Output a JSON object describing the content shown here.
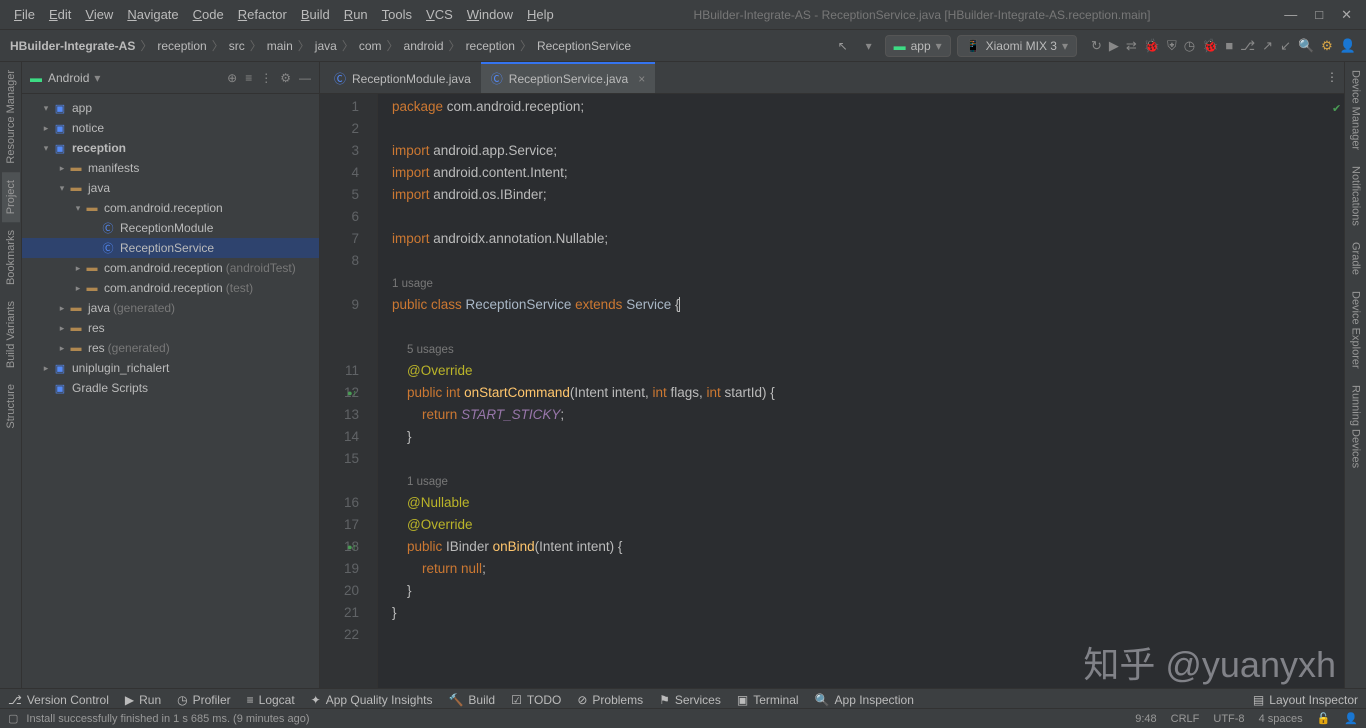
{
  "title": "HBuilder-Integrate-AS - ReceptionService.java [HBuilder-Integrate-AS.reception.main]",
  "menus": [
    "File",
    "Edit",
    "View",
    "Navigate",
    "Code",
    "Refactor",
    "Build",
    "Run",
    "Tools",
    "VCS",
    "Window",
    "Help"
  ],
  "breadcrumb": [
    "HBuilder-Integrate-AS",
    "reception",
    "src",
    "main",
    "java",
    "com",
    "android",
    "reception",
    "ReceptionService"
  ],
  "run_config": "app",
  "device": "Xiaomi MIX 3",
  "sidebar": {
    "view": "Android",
    "nodes": [
      {
        "d": 0,
        "arr": "▾",
        "ico": "mod",
        "txt": "app"
      },
      {
        "d": 0,
        "arr": "▸",
        "ico": "mod",
        "txt": "notice"
      },
      {
        "d": 0,
        "arr": "▾",
        "ico": "mod",
        "txt": "reception",
        "bold": true
      },
      {
        "d": 1,
        "arr": "▸",
        "ico": "fold",
        "txt": "manifests"
      },
      {
        "d": 1,
        "arr": "▾",
        "ico": "fold",
        "txt": "java"
      },
      {
        "d": 2,
        "arr": "▾",
        "ico": "fold",
        "txt": "com.android.reception"
      },
      {
        "d": 3,
        "arr": "",
        "ico": "cls",
        "txt": "ReceptionModule"
      },
      {
        "d": 3,
        "arr": "",
        "ico": "cls",
        "txt": "ReceptionService",
        "sel": true
      },
      {
        "d": 2,
        "arr": "▸",
        "ico": "fold",
        "txt": "com.android.reception",
        "dim": "(androidTest)"
      },
      {
        "d": 2,
        "arr": "▸",
        "ico": "fold",
        "txt": "com.android.reception",
        "dim": "(test)"
      },
      {
        "d": 1,
        "arr": "▸",
        "ico": "fold",
        "txt": "java",
        "dim": "(generated)",
        "gen": true
      },
      {
        "d": 1,
        "arr": "▸",
        "ico": "fold",
        "txt": "res"
      },
      {
        "d": 1,
        "arr": "▸",
        "ico": "fold",
        "txt": "res",
        "dim": "(generated)",
        "gen": true
      },
      {
        "d": 0,
        "arr": "▸",
        "ico": "mod",
        "txt": "uniplugin_richalert"
      },
      {
        "d": 0,
        "arr": "",
        "ico": "mod",
        "txt": "Gradle Scripts"
      }
    ]
  },
  "tabs": [
    {
      "label": "ReceptionModule.java",
      "active": false
    },
    {
      "label": "ReceptionService.java",
      "active": true
    }
  ],
  "code": {
    "lines": [
      {
        "n": 1,
        "h": "<span class='kw'>package</span> com.android.reception;"
      },
      {
        "n": 2,
        "h": ""
      },
      {
        "n": 3,
        "h": "<span class='kw'>import</span> android.app.Service;"
      },
      {
        "n": 4,
        "h": "<span class='kw'>import</span> android.content.Intent;"
      },
      {
        "n": 5,
        "h": "<span class='kw'>import</span> android.os.IBinder;"
      },
      {
        "n": 6,
        "h": ""
      },
      {
        "n": 7,
        "h": "<span class='kw'>import</span> androidx.annotation.Nullable;"
      },
      {
        "n": 8,
        "h": ""
      },
      {
        "n": "",
        "h": "<span class='usage'>1 usage</span>"
      },
      {
        "n": 9,
        "h": "<span class='kw'>public class</span> <span class='cls2'>ReceptionService</span> <span class='kw'>extends</span> <span class='cls2'>Service</span> {<span class='cursor'></span>"
      },
      {
        "n": "",
        "h": ""
      },
      {
        "n": "",
        "h": "    <span class='usage'>5 usages</span>"
      },
      {
        "n": 11,
        "h": "    <span class='ann'>@Override</span>"
      },
      {
        "n": 12,
        "h": "    <span class='kw'>public int</span> <span class='fn'>onStartCommand</span>(Intent intent, <span class='kw'>int</span> flags, <span class='kw'>int</span> startId) {",
        "gi": "●↑",
        "gic": "#499c54"
      },
      {
        "n": 13,
        "h": "        <span class='kw'>return</span> <span class='ital'>START_STICKY</span>;"
      },
      {
        "n": 14,
        "h": "    }"
      },
      {
        "n": 15,
        "h": ""
      },
      {
        "n": "",
        "h": "    <span class='usage'>1 usage</span>"
      },
      {
        "n": 16,
        "h": "    <span class='ann'>@Nullable</span>"
      },
      {
        "n": 17,
        "h": "    <span class='ann'>@Override</span>"
      },
      {
        "n": 18,
        "h": "    <span class='kw'>public</span> IBinder <span class='fn'>onBind</span>(Intent intent) {",
        "gi": "●↑",
        "gic": "#499c54"
      },
      {
        "n": 19,
        "h": "        <span class='kw'>return null</span>;"
      },
      {
        "n": 20,
        "h": "    }"
      },
      {
        "n": 21,
        "h": "}"
      },
      {
        "n": 22,
        "h": ""
      }
    ]
  },
  "left_tabs": [
    "Resource Manager",
    "Project",
    "Bookmarks",
    "Build Variants",
    "Structure"
  ],
  "right_tabs": [
    "Device Manager",
    "Notifications",
    "Gradle",
    "Device Explorer",
    "Running Devices"
  ],
  "bottom": [
    "Version Control",
    "Run",
    "Profiler",
    "Logcat",
    "App Quality Insights",
    "Build",
    "TODO",
    "Problems",
    "Services",
    "Terminal",
    "App Inspection"
  ],
  "bottom_right": "Layout Inspector",
  "status": {
    "msg": "Install successfully finished in 1 s 685 ms. (9 minutes ago)",
    "pos": "9:48",
    "eol": "CRLF",
    "enc": "UTF-8",
    "indent": "4 spaces"
  },
  "watermark": "知乎 @yuanyxh"
}
